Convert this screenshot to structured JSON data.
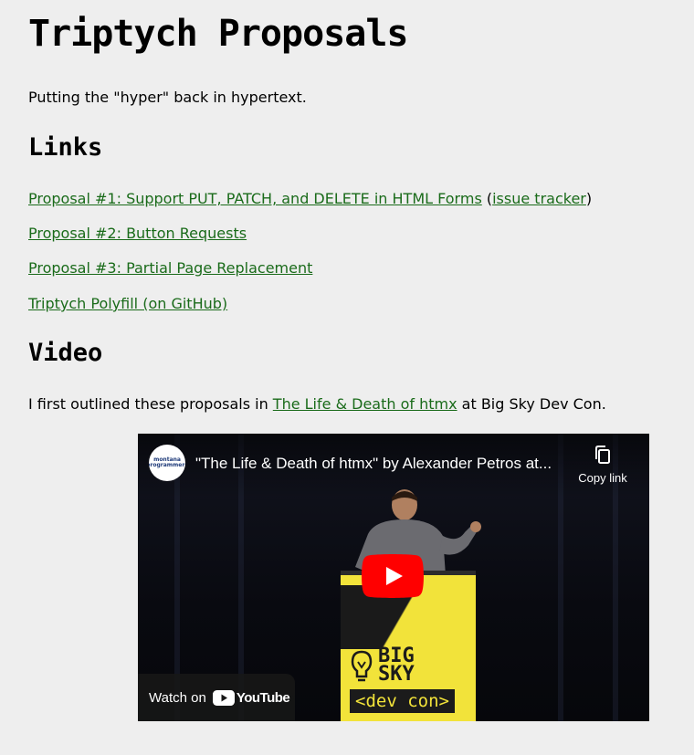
{
  "page": {
    "title": "Triptych Proposals",
    "tagline": "Putting the \"hyper\" back in hypertext."
  },
  "links_section": {
    "heading": "Links",
    "items": [
      {
        "label": "Proposal #1: Support PUT, PATCH, and DELETE in HTML Forms",
        "pre_extra": " (",
        "extra_label": "issue tracker",
        "post_extra": ")"
      },
      {
        "label": "Proposal #2: Button Requests"
      },
      {
        "label": "Proposal #3: Partial Page Replacement"
      },
      {
        "label": "Triptych Polyfill (on GitHub)"
      }
    ]
  },
  "video_section": {
    "heading": "Video",
    "intro_before": "I first outlined these proposals in ",
    "intro_link": "The Life & Death of htmx",
    "intro_after": " at Big Sky Dev Con."
  },
  "video_embed": {
    "title": "\"The Life & Death of htmx\" by Alexander Petros at...",
    "channel_avatar_text_top": "montana",
    "channel_avatar_text_bottom": "programmers",
    "copy_link_label": "Copy link",
    "watch_on_label": "Watch on",
    "youtube_label": "YouTube",
    "podium_text_line1": "BIG",
    "podium_text_line2": "SKY",
    "podium_badge": "<dev con>",
    "colors": {
      "link": "#1a6b1a",
      "podium": "#f2e33a",
      "youtube_red": "#ff0000",
      "background": "#eeeeee"
    }
  }
}
